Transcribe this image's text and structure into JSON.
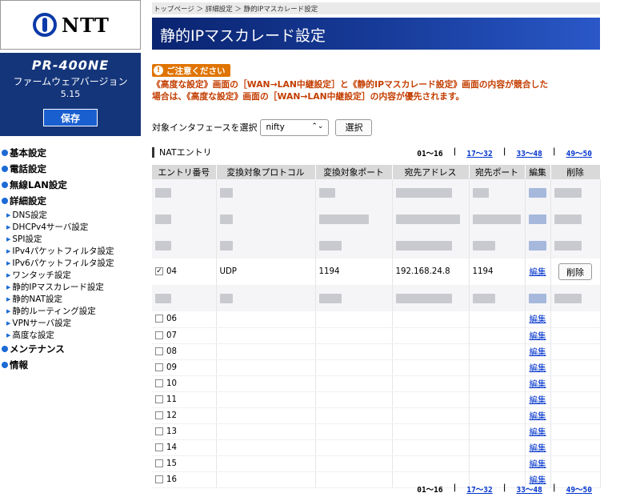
{
  "brand": {
    "logo_text": "NTT"
  },
  "device": {
    "model": "PR-400NE",
    "firmware_label": "ファームウェアバージョン",
    "firmware_version": "5.15",
    "save_label": "保存"
  },
  "menu": {
    "basic": "基本設定",
    "phone": "電話設定",
    "wlan": "無線LAN設定",
    "detail": "詳細設定",
    "detail_items": [
      "DNS設定",
      "DHCPv4サーバ設定",
      "SPI設定",
      "IPv4パケットフィルタ設定",
      "IPv6パケットフィルタ設定",
      "ワンタッチ設定",
      "静的IPマスカレード設定",
      "静的NAT設定",
      "静的ルーティング設定",
      "VPNサーバ設定",
      "高度な設定"
    ],
    "maintenance": "メンテナンス",
    "info": "情報"
  },
  "breadcrumb": "トップページ ＞ 詳細設定 ＞ 静的IPマスカレード設定",
  "page_title": "静的IPマスカレード設定",
  "warning": {
    "badge": "ご注意ください",
    "line1": "《高度な設定》画面の［WAN→LAN中継設定］と《静的IPマスカレード設定》画面の内容が競合した",
    "line2": "場合は、《高度な設定》画面の［WAN→LAN中継設定］の内容が優先されます。"
  },
  "interface": {
    "label": "対象インタフェースを選択",
    "selected": "nifty",
    "select_button": "選択"
  },
  "section_title": "NATエントリ",
  "pager": {
    "current": "01〜16",
    "p2": "17〜32",
    "p3": "33〜48",
    "p4": "49〜50",
    "sep": "|"
  },
  "table": {
    "headers": [
      "エントリ番号",
      "変換対象プロトコル",
      "変換対象ポート",
      "宛先アドレス",
      "宛先ポート",
      "編集",
      "削除"
    ],
    "entry4": {
      "number": "04",
      "protocol": "UDP",
      "port": "1194",
      "address": "192.168.24.8",
      "dest_port": "1194",
      "edit": "編集",
      "delete": "削除"
    },
    "empty_rows": [
      "06",
      "07",
      "08",
      "09",
      "10",
      "11",
      "12",
      "13",
      "14",
      "15",
      "16"
    ],
    "edit_label": "編集"
  }
}
